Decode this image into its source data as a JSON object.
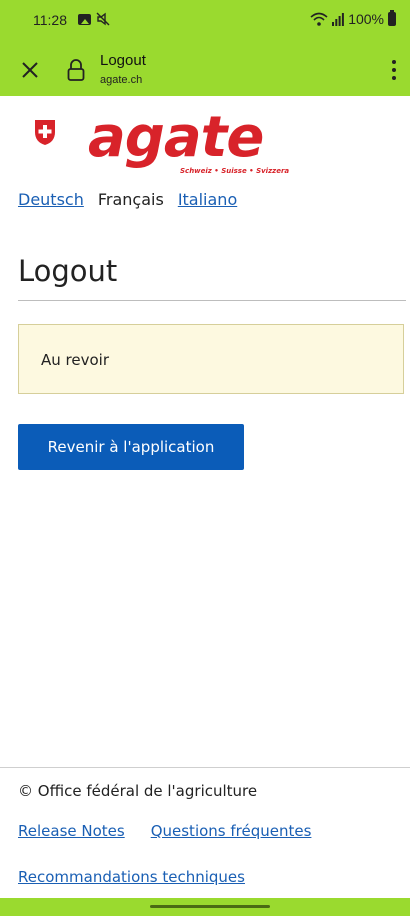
{
  "status": {
    "time": "11:28",
    "battery": "100%",
    "icons": [
      "photo-icon",
      "mute-icon",
      "wifi-icon",
      "signal-icon",
      "battery-icon"
    ]
  },
  "browser": {
    "tab_title": "Logout",
    "url": "agate.ch",
    "icons": [
      "close-icon",
      "lock-icon",
      "more-vert-icon"
    ]
  },
  "logo": {
    "wordmark": "agate",
    "tagline": "Schweiz • Suisse • Svizzera"
  },
  "languages": [
    {
      "label": "Deutsch",
      "current": false
    },
    {
      "label": "Français",
      "current": true
    },
    {
      "label": "Italiano",
      "current": false
    }
  ],
  "page": {
    "title": "Logout",
    "message": "Au revoir",
    "button_label": "Revenir à l'application"
  },
  "footer": {
    "copyright": "© Office fédéral de l'agriculture",
    "links": [
      "Release Notes",
      "Questions fréquentes",
      "Recommandations techniques"
    ]
  },
  "colors": {
    "accent": "#9ada2f",
    "primary_button": "#0b5cb8",
    "link": "#1a5fb4",
    "message_bg": "#fdf9e0",
    "logo_red": "#d8232a"
  }
}
